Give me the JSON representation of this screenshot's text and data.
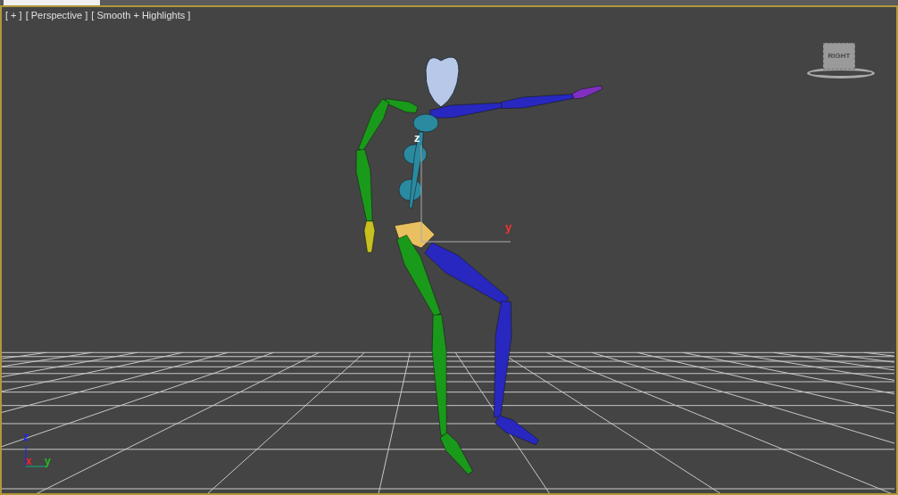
{
  "viewport": {
    "labels": [
      "[ + ]",
      "[ Perspective ]",
      "[ Smooth + Highlights ]"
    ],
    "viewcube": {
      "label": "RIGHT"
    },
    "gizmo": {
      "axes": [
        {
          "name": "z",
          "color": "#ffffff"
        },
        {
          "name": "y",
          "color": "#ff3030"
        }
      ]
    },
    "axis_tripod": {
      "axes": [
        {
          "name": "z",
          "color": "#2020ff"
        },
        {
          "name": "x",
          "color": "#ff2020"
        },
        {
          "name": "y",
          "color": "#20c020"
        }
      ]
    }
  }
}
